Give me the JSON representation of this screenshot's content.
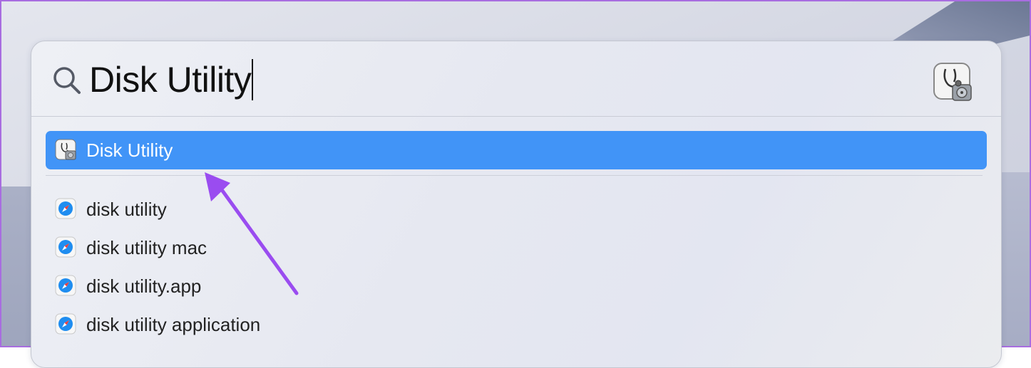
{
  "search": {
    "query": "Disk Utility"
  },
  "top_hit": {
    "label": "Disk Utility",
    "icon": "disk-utility-icon",
    "highlight_color": "#4194f7"
  },
  "web_suggestions": [
    {
      "label": "disk utility",
      "icon": "safari-icon"
    },
    {
      "label": "disk utility mac",
      "icon": "safari-icon"
    },
    {
      "label": "disk utility.app",
      "icon": "safari-icon"
    },
    {
      "label": "disk utility application",
      "icon": "safari-icon"
    }
  ],
  "annotation": {
    "arrow_color": "#9a4cf0"
  }
}
